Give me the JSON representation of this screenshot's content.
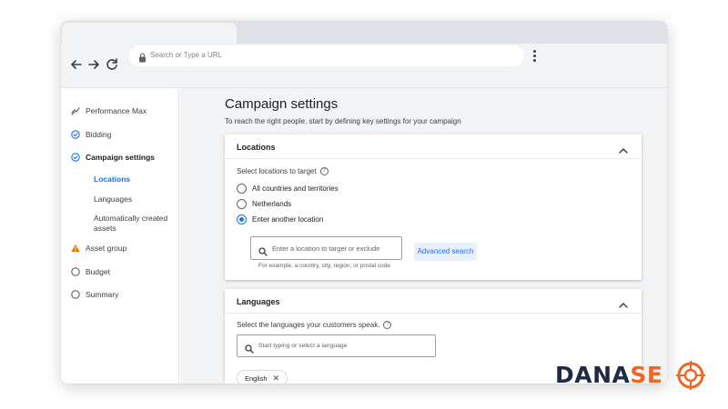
{
  "browser": {
    "url_placeholder": "Search or Type a URL"
  },
  "sidebar": {
    "items": [
      {
        "label": "Performance Max",
        "icon": "performance-max-icon"
      },
      {
        "label": "Bidding",
        "icon": "check-circle-icon"
      },
      {
        "label": "Campaign settings",
        "icon": "check-circle-icon"
      },
      {
        "label": "Asset group",
        "icon": "warning-icon"
      },
      {
        "label": "Budget",
        "icon": "empty-circle-icon"
      },
      {
        "label": "Summary",
        "icon": "empty-circle-icon"
      }
    ],
    "sub_items": [
      {
        "label": "Locations",
        "active": true
      },
      {
        "label": "Languages",
        "active": false
      },
      {
        "label": "Automatically created assets",
        "active": false
      }
    ]
  },
  "main": {
    "title": "Campaign settings",
    "subtitle": "To reach the right people, start by defining key settings for your campaign"
  },
  "locations": {
    "title": "Locations",
    "prompt": "Select locations to target",
    "options": [
      {
        "label": "All countries and territories",
        "selected": false
      },
      {
        "label": "Netherlands",
        "selected": false
      },
      {
        "label": "Enter another location",
        "selected": true
      }
    ],
    "search_placeholder": "Enter a location to target or exclude",
    "hint": "For example, a country, city, region, or postal code",
    "advanced_search": "Advanced search"
  },
  "languages": {
    "title": "Languages",
    "prompt": "Select the languages your customers speak.",
    "search_placeholder": "Start typing or select a language",
    "chips": [
      "English"
    ]
  },
  "watermark": {
    "text_main": "DANA",
    "text_accent": "SE"
  },
  "colors": {
    "accent": "#1a73e8",
    "warning": "#e37400",
    "brand_dark": "#1f2a44",
    "brand_orange": "#f26522"
  }
}
